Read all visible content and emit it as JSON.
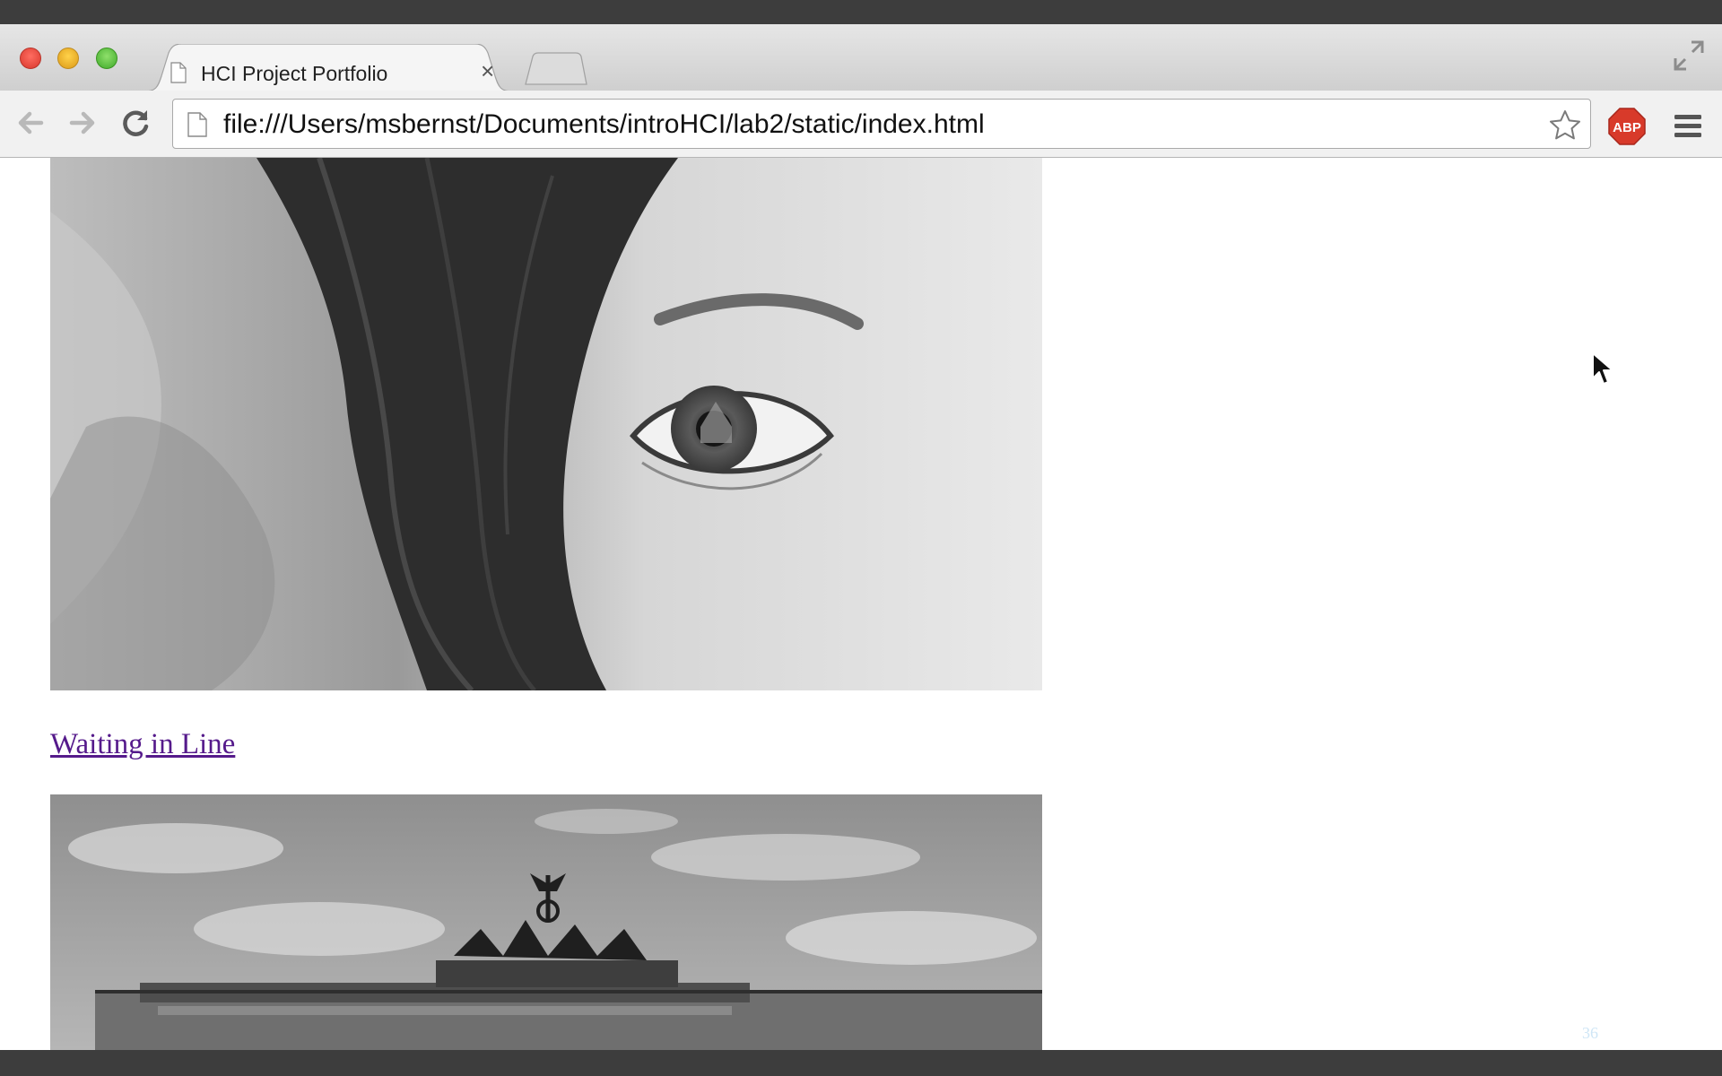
{
  "tab": {
    "title": "HCI Project Portfolio",
    "close_glyph": "×"
  },
  "toolbar": {
    "url": "file:///Users/msbernst/Documents/introHCI/lab2/static/index.html",
    "extension_badge": "ABP"
  },
  "content": {
    "link_text": "Waiting in Line",
    "slide_number": "36"
  },
  "icons": {
    "back": "back-arrow-icon",
    "forward": "forward-arrow-icon",
    "reload": "reload-icon",
    "bookmark": "star-icon",
    "menu": "hamburger-menu-icon",
    "fullscreen": "fullscreen-icon",
    "page": "document-icon"
  },
  "colors": {
    "link_visited": "#551a8b",
    "abp_red": "#d83a2a",
    "window_frame": "#3d3d3d"
  }
}
